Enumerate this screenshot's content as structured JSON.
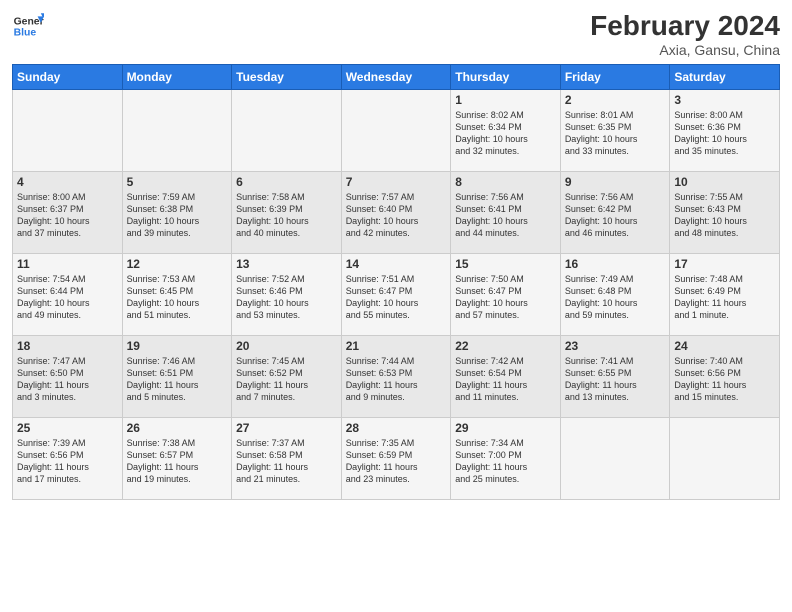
{
  "header": {
    "logo_line1": "General",
    "logo_line2": "Blue",
    "title": "February 2024",
    "subtitle": "Axia, Gansu, China"
  },
  "days_of_week": [
    "Sunday",
    "Monday",
    "Tuesday",
    "Wednesday",
    "Thursday",
    "Friday",
    "Saturday"
  ],
  "weeks": [
    [
      {
        "day": "",
        "info": ""
      },
      {
        "day": "",
        "info": ""
      },
      {
        "day": "",
        "info": ""
      },
      {
        "day": "",
        "info": ""
      },
      {
        "day": "1",
        "info": "Sunrise: 8:02 AM\nSunset: 6:34 PM\nDaylight: 10 hours\nand 32 minutes."
      },
      {
        "day": "2",
        "info": "Sunrise: 8:01 AM\nSunset: 6:35 PM\nDaylight: 10 hours\nand 33 minutes."
      },
      {
        "day": "3",
        "info": "Sunrise: 8:00 AM\nSunset: 6:36 PM\nDaylight: 10 hours\nand 35 minutes."
      }
    ],
    [
      {
        "day": "4",
        "info": "Sunrise: 8:00 AM\nSunset: 6:37 PM\nDaylight: 10 hours\nand 37 minutes."
      },
      {
        "day": "5",
        "info": "Sunrise: 7:59 AM\nSunset: 6:38 PM\nDaylight: 10 hours\nand 39 minutes."
      },
      {
        "day": "6",
        "info": "Sunrise: 7:58 AM\nSunset: 6:39 PM\nDaylight: 10 hours\nand 40 minutes."
      },
      {
        "day": "7",
        "info": "Sunrise: 7:57 AM\nSunset: 6:40 PM\nDaylight: 10 hours\nand 42 minutes."
      },
      {
        "day": "8",
        "info": "Sunrise: 7:56 AM\nSunset: 6:41 PM\nDaylight: 10 hours\nand 44 minutes."
      },
      {
        "day": "9",
        "info": "Sunrise: 7:56 AM\nSunset: 6:42 PM\nDaylight: 10 hours\nand 46 minutes."
      },
      {
        "day": "10",
        "info": "Sunrise: 7:55 AM\nSunset: 6:43 PM\nDaylight: 10 hours\nand 48 minutes."
      }
    ],
    [
      {
        "day": "11",
        "info": "Sunrise: 7:54 AM\nSunset: 6:44 PM\nDaylight: 10 hours\nand 49 minutes."
      },
      {
        "day": "12",
        "info": "Sunrise: 7:53 AM\nSunset: 6:45 PM\nDaylight: 10 hours\nand 51 minutes."
      },
      {
        "day": "13",
        "info": "Sunrise: 7:52 AM\nSunset: 6:46 PM\nDaylight: 10 hours\nand 53 minutes."
      },
      {
        "day": "14",
        "info": "Sunrise: 7:51 AM\nSunset: 6:47 PM\nDaylight: 10 hours\nand 55 minutes."
      },
      {
        "day": "15",
        "info": "Sunrise: 7:50 AM\nSunset: 6:47 PM\nDaylight: 10 hours\nand 57 minutes."
      },
      {
        "day": "16",
        "info": "Sunrise: 7:49 AM\nSunset: 6:48 PM\nDaylight: 10 hours\nand 59 minutes."
      },
      {
        "day": "17",
        "info": "Sunrise: 7:48 AM\nSunset: 6:49 PM\nDaylight: 11 hours\nand 1 minute."
      }
    ],
    [
      {
        "day": "18",
        "info": "Sunrise: 7:47 AM\nSunset: 6:50 PM\nDaylight: 11 hours\nand 3 minutes."
      },
      {
        "day": "19",
        "info": "Sunrise: 7:46 AM\nSunset: 6:51 PM\nDaylight: 11 hours\nand 5 minutes."
      },
      {
        "day": "20",
        "info": "Sunrise: 7:45 AM\nSunset: 6:52 PM\nDaylight: 11 hours\nand 7 minutes."
      },
      {
        "day": "21",
        "info": "Sunrise: 7:44 AM\nSunset: 6:53 PM\nDaylight: 11 hours\nand 9 minutes."
      },
      {
        "day": "22",
        "info": "Sunrise: 7:42 AM\nSunset: 6:54 PM\nDaylight: 11 hours\nand 11 minutes."
      },
      {
        "day": "23",
        "info": "Sunrise: 7:41 AM\nSunset: 6:55 PM\nDaylight: 11 hours\nand 13 minutes."
      },
      {
        "day": "24",
        "info": "Sunrise: 7:40 AM\nSunset: 6:56 PM\nDaylight: 11 hours\nand 15 minutes."
      }
    ],
    [
      {
        "day": "25",
        "info": "Sunrise: 7:39 AM\nSunset: 6:56 PM\nDaylight: 11 hours\nand 17 minutes."
      },
      {
        "day": "26",
        "info": "Sunrise: 7:38 AM\nSunset: 6:57 PM\nDaylight: 11 hours\nand 19 minutes."
      },
      {
        "day": "27",
        "info": "Sunrise: 7:37 AM\nSunset: 6:58 PM\nDaylight: 11 hours\nand 21 minutes."
      },
      {
        "day": "28",
        "info": "Sunrise: 7:35 AM\nSunset: 6:59 PM\nDaylight: 11 hours\nand 23 minutes."
      },
      {
        "day": "29",
        "info": "Sunrise: 7:34 AM\nSunset: 7:00 PM\nDaylight: 11 hours\nand 25 minutes."
      },
      {
        "day": "",
        "info": ""
      },
      {
        "day": "",
        "info": ""
      }
    ]
  ]
}
